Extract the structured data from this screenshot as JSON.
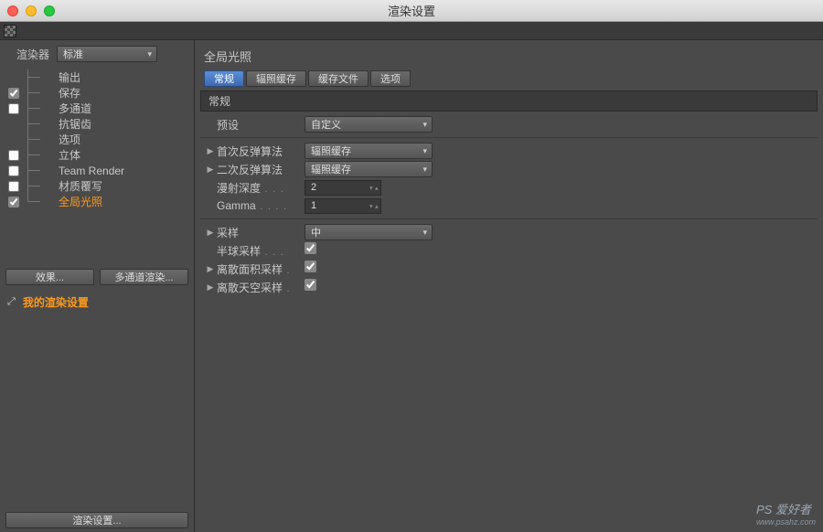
{
  "window": {
    "title": "渲染设置"
  },
  "toolbar_icon": "checker-icon",
  "renderer": {
    "label": "渲染器",
    "selected": "标准"
  },
  "sidebar": {
    "items": [
      {
        "label": "输出",
        "checkbox": null,
        "checked": false
      },
      {
        "label": "保存",
        "checkbox": true,
        "checked": true
      },
      {
        "label": "多通道",
        "checkbox": true,
        "checked": false
      },
      {
        "label": "抗锯齿",
        "checkbox": null,
        "checked": false
      },
      {
        "label": "选项",
        "checkbox": null,
        "checked": false
      },
      {
        "label": "立体",
        "checkbox": true,
        "checked": false
      },
      {
        "label": "Team Render",
        "checkbox": true,
        "checked": false
      },
      {
        "label": "材质覆写",
        "checkbox": true,
        "checked": false
      },
      {
        "label": "全局光照",
        "checkbox": true,
        "checked": true
      }
    ],
    "active_index": 8,
    "effects_btn": "效果...",
    "multipass_btn": "多通道渲染...",
    "my_settings": "我的渲染设置",
    "render_settings_btn": "渲染设置..."
  },
  "panel": {
    "title": "全局光照",
    "tabs": [
      "常规",
      "辐照缓存",
      "缓存文件",
      "选项"
    ],
    "active_tab": 0,
    "section_title": "常规",
    "preset": {
      "label": "预设",
      "value": "自定义"
    },
    "primary": {
      "label": "首次反弹算法",
      "value": "辐照缓存"
    },
    "secondary": {
      "label": "二次反弹算法",
      "value": "辐照缓存"
    },
    "diffuse_depth": {
      "label": "漫射深度",
      "value": "2"
    },
    "gamma": {
      "label": "Gamma",
      "value": "1"
    },
    "sampling": {
      "label": "采样",
      "value": "中"
    },
    "hemi": {
      "label": "半球采样",
      "checked": true
    },
    "area": {
      "label": "离散面积采样",
      "checked": true
    },
    "sky": {
      "label": "离散天空采样",
      "checked": true
    }
  },
  "watermark": {
    "main": "PS 爱好者",
    "sub": "www.psahz.com"
  }
}
